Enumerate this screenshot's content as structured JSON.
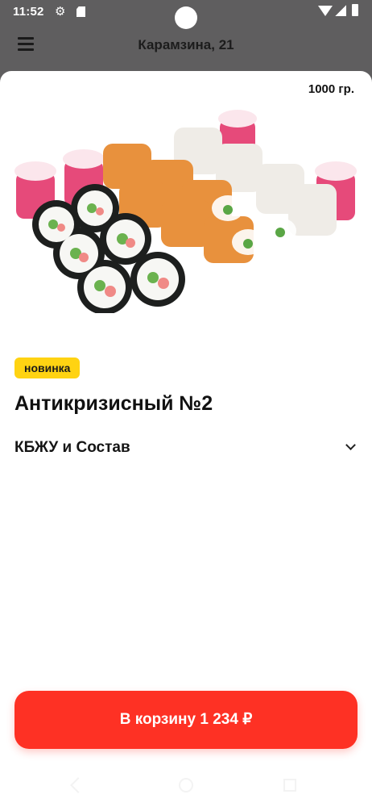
{
  "status_bar": {
    "time": "11:52",
    "icons": [
      "gear-icon",
      "sd-card-icon",
      "wifi-icon",
      "signal-icon",
      "battery-icon"
    ]
  },
  "header": {
    "menu_icon": "hamburger-menu-icon",
    "address": "Карамзина,  21"
  },
  "product": {
    "weight": "1000 гр.",
    "badge": "новинка",
    "title": "Антикризисный №2",
    "composition_label": "КБЖУ и Состав",
    "image": "sushi-set-image"
  },
  "cart": {
    "button_label": "В корзину 1 234 ₽"
  },
  "colors": {
    "header_bg": "#5f5e5f",
    "badge_bg": "#ffd312",
    "cart_button_bg": "#fe3124"
  }
}
